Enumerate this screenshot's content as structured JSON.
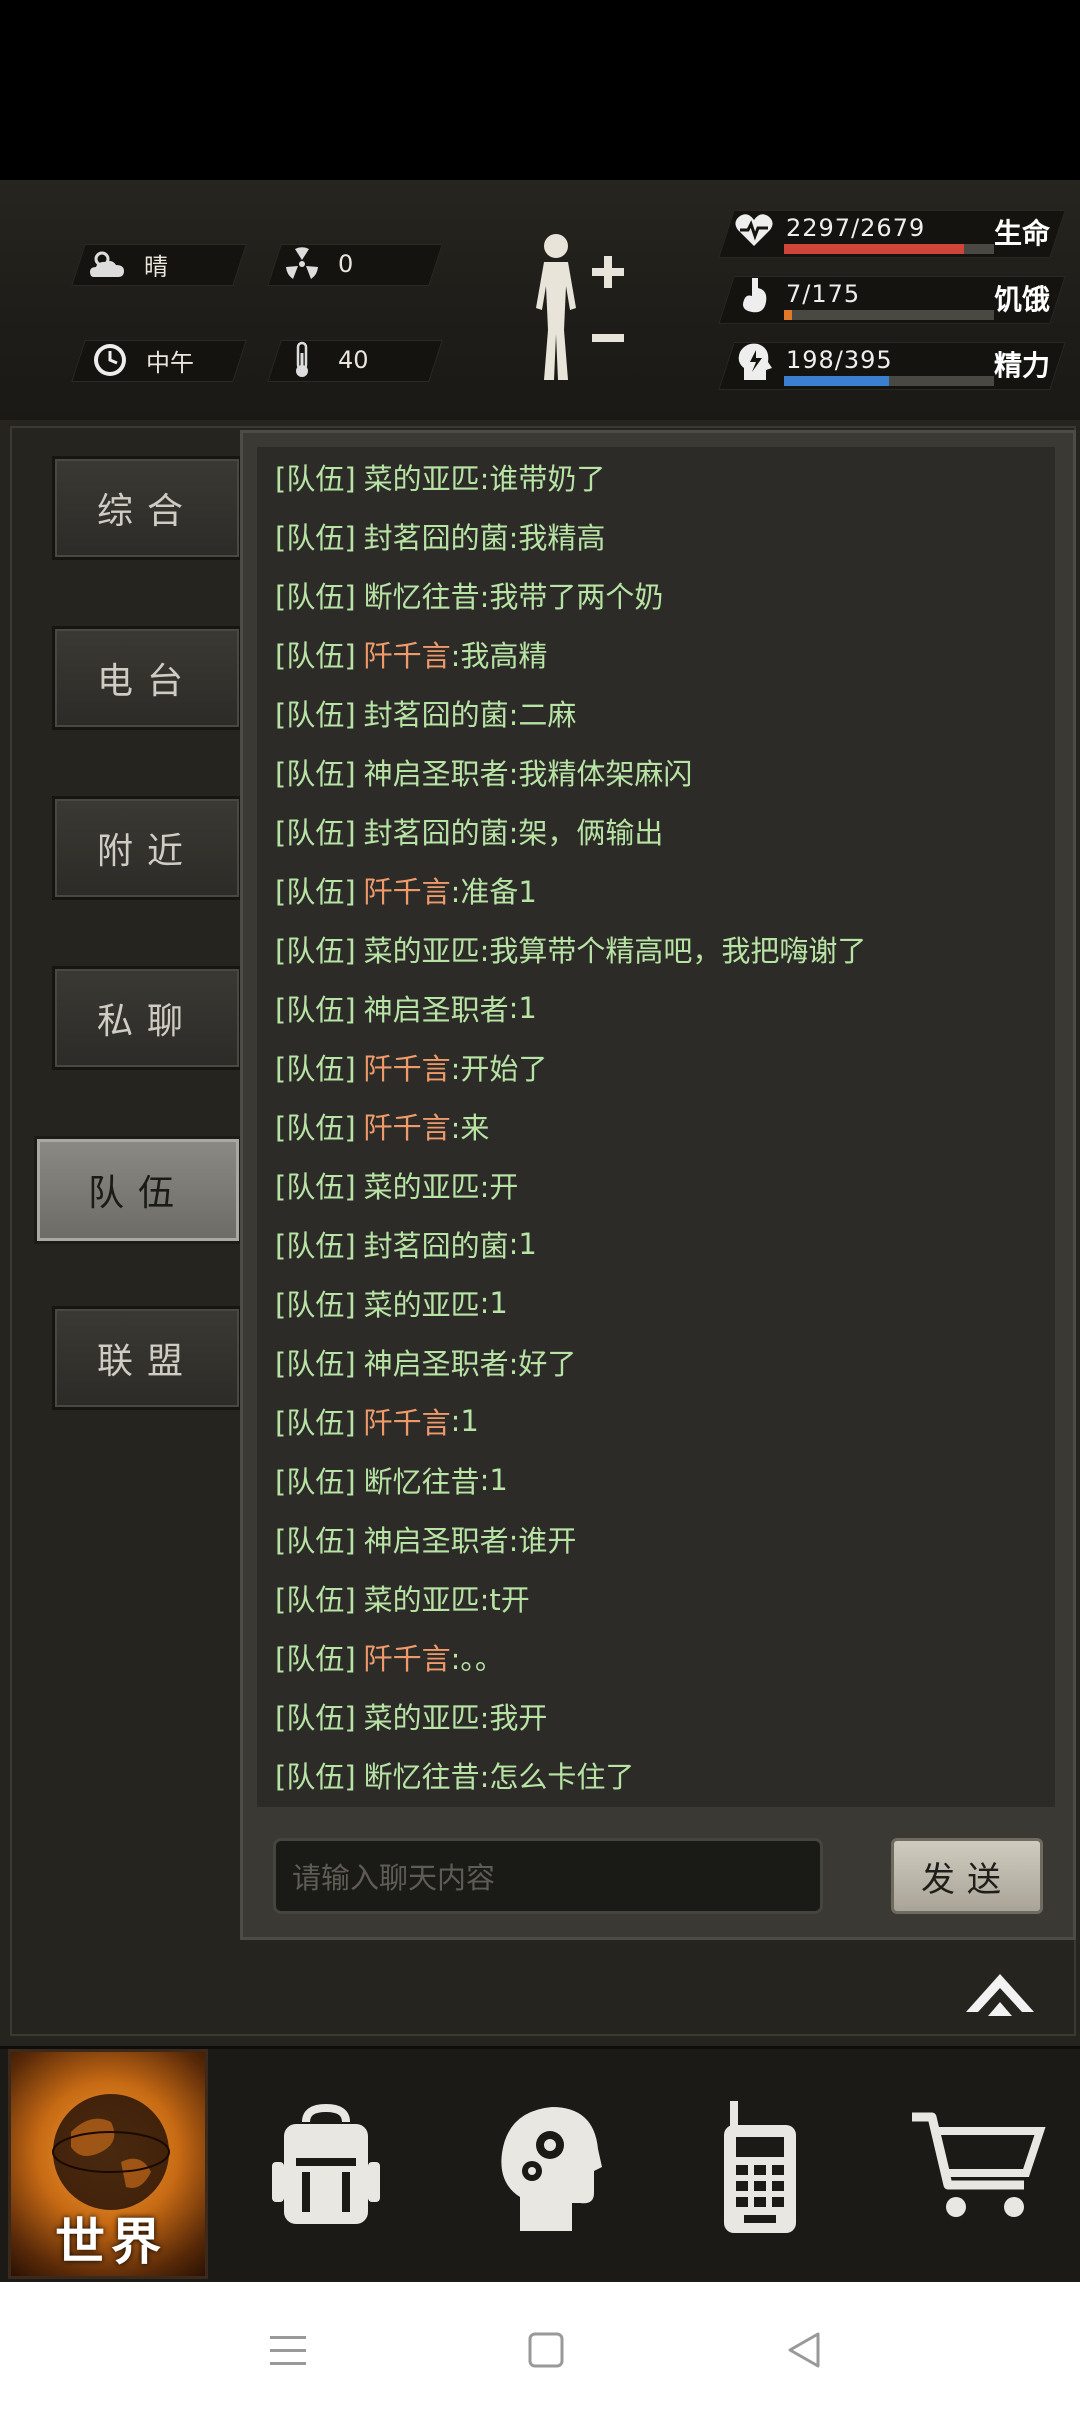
{
  "hud": {
    "weather": {
      "icon": "partly-cloudy-icon",
      "label": "晴"
    },
    "radiation": {
      "icon": "radiation-icon",
      "value": "0"
    },
    "time": {
      "icon": "clock-icon",
      "label": "中午"
    },
    "temperature": {
      "icon": "thermometer-icon",
      "value": "40"
    },
    "stats": [
      {
        "name": "生命",
        "value": "2297/2679",
        "fraction": 0.857,
        "color": "#d0453a",
        "icon": "heart-pulse-icon"
      },
      {
        "name": "饥饿",
        "value": "7/175",
        "fraction": 0.04,
        "color": "#e07a2a",
        "icon": "stomach-icon"
      },
      {
        "name": "精力",
        "value": "198/395",
        "fraction": 0.5,
        "color": "#3b7fd1",
        "icon": "energy-head-icon"
      }
    ]
  },
  "tabs": [
    {
      "label": "综合"
    },
    {
      "label": "电台"
    },
    {
      "label": "附近"
    },
    {
      "label": "私聊"
    },
    {
      "label": "队伍",
      "active": true
    },
    {
      "label": "联盟"
    }
  ],
  "chat": {
    "channel": "[队伍]",
    "messages": [
      {
        "name": "菜的亚匹",
        "text": ":谁带奶了",
        "special": false
      },
      {
        "name": "封茗囧的菌",
        "text": ":我精高",
        "special": false
      },
      {
        "name": "断忆往昔",
        "text": ":我带了两个奶",
        "special": false
      },
      {
        "name": "阡千言",
        "text": ":我高精",
        "special": true
      },
      {
        "name": "封茗囧的菌",
        "text": ":二麻",
        "special": false
      },
      {
        "name": "神启圣职者",
        "text": ":我精体架麻闪",
        "special": false
      },
      {
        "name": "封茗囧的菌",
        "text": ":架，俩输出",
        "special": false
      },
      {
        "name": "阡千言",
        "text": ":准备1",
        "special": true
      },
      {
        "name": "菜的亚匹",
        "text": ":我算带个精高吧，我把嗨谢了",
        "special": false
      },
      {
        "name": "神启圣职者",
        "text": ":1",
        "special": false
      },
      {
        "name": "阡千言",
        "text": ":开始了",
        "special": true
      },
      {
        "name": "阡千言",
        "text": ":来",
        "special": true
      },
      {
        "name": "菜的亚匹",
        "text": ":开",
        "special": false
      },
      {
        "name": "封茗囧的菌",
        "text": ":1",
        "special": false
      },
      {
        "name": "菜的亚匹",
        "text": ":1",
        "special": false
      },
      {
        "name": "神启圣职者",
        "text": ":好了",
        "special": false
      },
      {
        "name": "阡千言",
        "text": ":1",
        "special": true
      },
      {
        "name": "断忆往昔",
        "text": ":1",
        "special": false
      },
      {
        "name": "神启圣职者",
        "text": ":谁开",
        "special": false
      },
      {
        "name": "菜的亚匹",
        "text": ":t开",
        "special": false
      },
      {
        "name": "阡千言",
        "text": ":。。",
        "special": true
      },
      {
        "name": "菜的亚匹",
        "text": ":我开",
        "special": false
      },
      {
        "name": "断忆往昔",
        "text": ":怎么卡住了",
        "special": false
      }
    ],
    "input_placeholder": "请输入聊天内容",
    "send_label": "发送"
  },
  "bottom_nav": {
    "world_label": "世界",
    "items": [
      {
        "icon": "globe-icon"
      },
      {
        "icon": "backpack-icon"
      },
      {
        "icon": "skills-head-icon"
      },
      {
        "icon": "walkie-talkie-icon"
      },
      {
        "icon": "shopping-cart-icon"
      }
    ]
  },
  "system_nav": [
    "menu-icon",
    "home-icon",
    "back-icon"
  ]
}
